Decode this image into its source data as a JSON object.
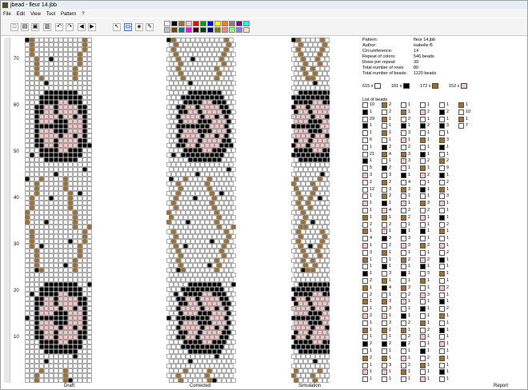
{
  "window": {
    "title": "jbead - fleur 14.jbb"
  },
  "menu": [
    {
      "label": "File",
      "u": "F"
    },
    {
      "label": "Edit",
      "u": "E"
    },
    {
      "label": "View",
      "u": "V"
    },
    {
      "label": "Tool",
      "u": "T"
    },
    {
      "label": "Pattern",
      "u": "P"
    },
    {
      "label": "?",
      "u": "?"
    }
  ],
  "toolbar": {
    "icons": [
      "new-icon",
      "open-icon",
      "save-icon",
      "print-icon",
      "undo-icon",
      "redo-icon",
      "arrow-left-icon",
      "arrow-right-icon",
      "pointer-icon",
      "select-icon",
      "fill-icon",
      "pipette-icon"
    ],
    "glyphs": [
      "□",
      "▤",
      "▣",
      "▥",
      "↶",
      "↷",
      "◀",
      "▶",
      "↖",
      "▭",
      "◈",
      "✎"
    ],
    "palette": [
      "#ffffff",
      "#000000",
      "#a0702a",
      "#f2c6c8",
      "#ff0000",
      "#00a000",
      "#0000ff",
      "#ffff00",
      "#ff8000",
      "#808080",
      "#800080",
      "#00ffff",
      "#c0c0c0",
      "#804000",
      "#008080",
      "#ff00ff",
      "#400000",
      "#004000",
      "#000080",
      "#808000",
      "#ff8080",
      "#80ff80",
      "#8080ff",
      "#ffe0a0"
    ]
  },
  "colors": {
    "white": "#ffffff",
    "black": "#000000",
    "brown": "#a0702a",
    "pink": "#f2c6c8"
  },
  "ruler": {
    "labels": [
      "70",
      "60",
      "50",
      "40",
      "30",
      "20",
      "10"
    ]
  },
  "panels": {
    "draft": "Draft",
    "corrected": "Corrected",
    "simulation": "Simulation",
    "report": "Report"
  },
  "info": [
    {
      "k": "Pattern:",
      "v": "fleur 14.jbb"
    },
    {
      "k": "Author:",
      "v": "isabelle B"
    },
    {
      "k": "Circumference:",
      "v": "14"
    },
    {
      "k": "Repeat of colors:",
      "v": "546 beads"
    },
    {
      "k": "Rows per repeat:",
      "v": "39"
    },
    {
      "k": "Total number of rows:",
      "v": "80"
    },
    {
      "k": "Total number of beads:",
      "v": "1120 beads"
    }
  ],
  "counts": [
    {
      "n": "615 x",
      "color": "#ffffff"
    },
    {
      "n": "181 x",
      "color": "#000000"
    },
    {
      "n": "172 x",
      "color": "#a0702a"
    },
    {
      "n": "152 x",
      "color": "#f2c6c8"
    }
  ],
  "list_title": "List of beads",
  "bead_list": [
    [
      [
        "w",
        "10"
      ],
      [
        "k",
        "1"
      ],
      [
        "w",
        "29"
      ],
      [
        "k",
        "1"
      ],
      [
        "w",
        "1"
      ],
      [
        "w",
        "6"
      ],
      [
        "w",
        "1"
      ],
      [
        "w",
        "21"
      ],
      [
        "k",
        "1"
      ],
      [
        "w",
        "5"
      ],
      [
        "p",
        "3"
      ],
      [
        "w",
        "2"
      ],
      [
        "w",
        "12"
      ],
      [
        "w",
        "1"
      ],
      [
        "p",
        "1"
      ],
      [
        "w",
        "1"
      ],
      [
        "b",
        "1"
      ],
      [
        "w",
        "2"
      ],
      [
        "b",
        "1"
      ],
      [
        "w",
        "4"
      ],
      [
        "p",
        "1"
      ],
      [
        "w",
        "3"
      ],
      [
        "b",
        "1"
      ],
      [
        "w",
        "1"
      ],
      [
        "k",
        "1"
      ],
      [
        "w",
        "2"
      ],
      [
        "b",
        "1"
      ],
      [
        "w",
        "2"
      ],
      [
        "b",
        "1"
      ],
      [
        "w",
        "1"
      ],
      [
        "p",
        "2"
      ],
      [
        "w",
        "1"
      ],
      [
        "b",
        "1"
      ],
      [
        "w",
        "1"
      ],
      [
        "k",
        "2"
      ],
      [
        "w",
        "1"
      ],
      [
        "b",
        "2"
      ],
      [
        "w",
        "1"
      ],
      [
        "p",
        "1"
      ],
      [
        "w",
        "1"
      ]
    ],
    [
      [
        "b",
        "2"
      ],
      [
        "w",
        "2"
      ],
      [
        "b",
        "1"
      ],
      [
        "w",
        "1"
      ],
      [
        "b",
        "1"
      ],
      [
        "w",
        "1"
      ],
      [
        "k",
        "2"
      ],
      [
        "b",
        "4"
      ],
      [
        "w",
        "1"
      ],
      [
        "k",
        "2"
      ],
      [
        "w",
        "3"
      ],
      [
        "b",
        "2"
      ],
      [
        "w",
        "3"
      ],
      [
        "b",
        "2"
      ],
      [
        "k",
        "1"
      ],
      [
        "p",
        "4"
      ],
      [
        "b",
        "1"
      ],
      [
        "w",
        "2"
      ],
      [
        "p",
        "1"
      ],
      [
        "k",
        "3"
      ],
      [
        "w",
        "2"
      ],
      [
        "b",
        "1"
      ],
      [
        "w",
        "1"
      ],
      [
        "k",
        "1"
      ],
      [
        "w",
        "3"
      ],
      [
        "b",
        "1"
      ],
      [
        "k",
        "4"
      ],
      [
        "w",
        "1"
      ],
      [
        "b",
        "3"
      ],
      [
        "w",
        "3"
      ],
      [
        "p",
        "1"
      ],
      [
        "w",
        "3"
      ],
      [
        "b",
        "1"
      ],
      [
        "w",
        "1"
      ],
      [
        "k",
        "2"
      ],
      [
        "w",
        "1"
      ],
      [
        "b",
        "1"
      ],
      [
        "w",
        "3"
      ],
      [
        "p",
        "1"
      ],
      [
        "w",
        "1"
      ]
    ],
    [
      [
        "w",
        "1"
      ],
      [
        "b",
        "1"
      ],
      [
        "w",
        "2"
      ],
      [
        "k",
        "1"
      ],
      [
        "w",
        "3"
      ],
      [
        "p",
        "1"
      ],
      [
        "w",
        "2"
      ],
      [
        "b",
        "3"
      ],
      [
        "p",
        "3"
      ],
      [
        "w",
        "1"
      ],
      [
        "k",
        "1"
      ],
      [
        "w",
        "4"
      ],
      [
        "b",
        "3"
      ],
      [
        "w",
        "1"
      ],
      [
        "p",
        "1"
      ],
      [
        "w",
        "2"
      ],
      [
        "b",
        "2"
      ],
      [
        "w",
        "1"
      ],
      [
        "k",
        "1"
      ],
      [
        "w",
        "3"
      ],
      [
        "p",
        "3"
      ],
      [
        "w",
        "1"
      ],
      [
        "b",
        "2"
      ],
      [
        "w",
        "1"
      ],
      [
        "k",
        "1"
      ],
      [
        "w",
        "1"
      ],
      [
        "b",
        "3"
      ],
      [
        "w",
        "2"
      ],
      [
        "p",
        "1"
      ],
      [
        "w",
        "1"
      ],
      [
        "k",
        "1"
      ],
      [
        "w",
        "2"
      ],
      [
        "b",
        "1"
      ],
      [
        "w",
        "2"
      ],
      [
        "k",
        "2"
      ],
      [
        "w",
        "1"
      ],
      [
        "p",
        "1"
      ],
      [
        "w",
        "2"
      ],
      [
        "b",
        "1"
      ],
      [
        "w",
        "1"
      ]
    ],
    [
      [
        "w",
        "1"
      ],
      [
        "p",
        "2"
      ],
      [
        "w",
        "1"
      ],
      [
        "k",
        "2"
      ],
      [
        "w",
        "1"
      ],
      [
        "b",
        "1"
      ],
      [
        "w",
        "1"
      ],
      [
        "k",
        "1"
      ],
      [
        "w",
        "2"
      ],
      [
        "b",
        "1"
      ],
      [
        "p",
        "2"
      ],
      [
        "w",
        "1"
      ],
      [
        "k",
        "1"
      ],
      [
        "w",
        "1"
      ],
      [
        "b",
        "3"
      ],
      [
        "w",
        "2"
      ],
      [
        "p",
        "1"
      ],
      [
        "w",
        "1"
      ],
      [
        "k",
        "1"
      ],
      [
        "w",
        "1"
      ],
      [
        "b",
        "2"
      ],
      [
        "w",
        "1"
      ],
      [
        "p",
        "2"
      ],
      [
        "k",
        "1"
      ],
      [
        "w",
        "3"
      ],
      [
        "b",
        "1"
      ],
      [
        "w",
        "1"
      ],
      [
        "p",
        "3"
      ],
      [
        "w",
        "1"
      ],
      [
        "k",
        "1"
      ],
      [
        "w",
        "1"
      ],
      [
        "b",
        "1"
      ],
      [
        "w",
        "2"
      ],
      [
        "p",
        "1"
      ],
      [
        "w",
        "1"
      ],
      [
        "k",
        "1"
      ],
      [
        "w",
        "2"
      ],
      [
        "b",
        "1"
      ],
      [
        "w",
        "1"
      ],
      [
        "p",
        "1"
      ]
    ],
    [
      [
        "w",
        "1"
      ],
      [
        "k",
        "2"
      ],
      [
        "w",
        "1"
      ],
      [
        "k",
        "3"
      ],
      [
        "w",
        "1"
      ],
      [
        "b",
        "3"
      ],
      [
        "k",
        "1"
      ],
      [
        "w",
        "1"
      ],
      [
        "b",
        "2"
      ],
      [
        "w",
        "9"
      ],
      [
        "k",
        "1"
      ],
      [
        "w",
        "2"
      ],
      [
        "b",
        "1"
      ],
      [
        "w",
        "3"
      ],
      [
        "p",
        "1"
      ],
      [
        "w",
        "1"
      ],
      [
        "k",
        "1"
      ],
      [
        "w",
        "2"
      ],
      [
        "b",
        "1"
      ],
      [
        "w",
        "1"
      ],
      [
        "p",
        "1"
      ],
      [
        "w",
        "2"
      ],
      [
        "k",
        "1"
      ],
      [
        "w",
        "1"
      ],
      [
        "b",
        "1"
      ],
      [
        "w",
        "1"
      ],
      [
        "p",
        "2"
      ],
      [
        "w",
        "1"
      ],
      [
        "k",
        "1"
      ],
      [
        "w",
        "2"
      ],
      [
        "b",
        "1"
      ],
      [
        "w",
        "1"
      ],
      [
        "k",
        "1"
      ],
      [
        "w",
        "1"
      ],
      [
        "p",
        "1"
      ],
      [
        "w",
        "1"
      ],
      [
        "b",
        "1"
      ],
      [
        "w",
        "1"
      ],
      [
        "k",
        "1"
      ],
      [
        "w",
        "1"
      ]
    ],
    [
      [
        "b",
        "1"
      ],
      [
        "w",
        "10"
      ],
      [
        "b",
        "1"
      ],
      [
        "w",
        "7"
      ]
    ]
  ]
}
